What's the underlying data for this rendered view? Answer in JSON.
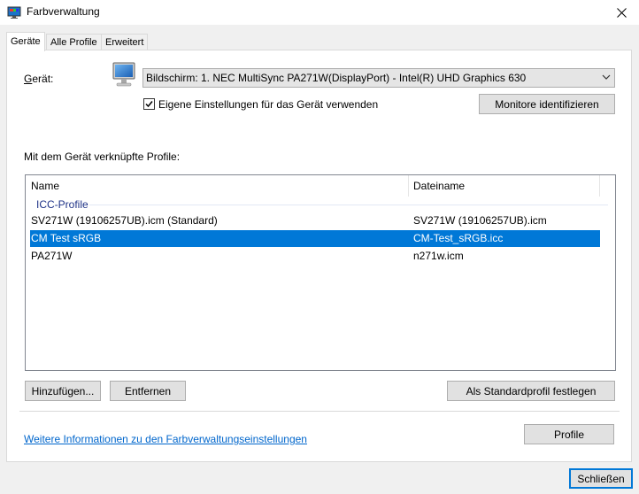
{
  "window": {
    "title": "Farbverwaltung"
  },
  "tabs": [
    {
      "label": "Geräte",
      "active": true
    },
    {
      "label": "Alle Profile",
      "active": false
    },
    {
      "label": "Erweitert",
      "active": false
    }
  ],
  "device": {
    "label": "Gerät:",
    "selected": "Bildschirm: 1. NEC MultiSync PA271W(DisplayPort) - Intel(R) UHD Graphics 630",
    "use_own_settings_label": "Eigene Einstellungen für das Gerät verwenden",
    "use_own_settings_checked": true,
    "identify_button": "Monitore identifizieren"
  },
  "profiles": {
    "section_label": "Mit dem Gerät verknüpfte Profile:",
    "columns": [
      "Name",
      "Dateiname"
    ],
    "group": "ICC-Profile",
    "rows": [
      {
        "name": "SV271W (19106257UB).icm (Standard)",
        "file": "SV271W (19106257UB).icm",
        "selected": false
      },
      {
        "name": "CM Test sRGB",
        "file": "CM-Test_sRGB.icc",
        "selected": true
      },
      {
        "name": "PA271W",
        "file": "n271w.icm",
        "selected": false
      }
    ]
  },
  "buttons": {
    "add": "Hinzufügen...",
    "remove": "Entfernen",
    "set_default": "Als Standardprofil festlegen",
    "profile": "Profile",
    "close": "Schließen"
  },
  "more_info_link": "Weitere Informationen zu den Farbverwaltungseinstellungen",
  "colors": {
    "accent": "#0078d7",
    "link": "#0066cc",
    "group": "#1e3287"
  }
}
